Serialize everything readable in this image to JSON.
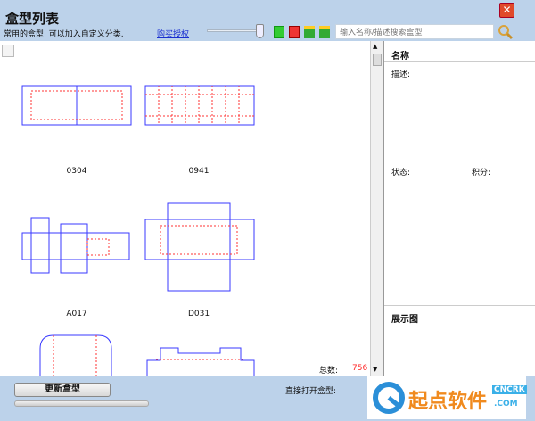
{
  "header": {
    "title": "盒型列表",
    "subtitle": "常用的盒型, 可以加入自定义分类.",
    "buy_link": "购买授权",
    "search_placeholder": "输入名称/描述搜索盒型",
    "slider_value": 1.0
  },
  "boxes": [
    {
      "label": "0304"
    },
    {
      "label": "0941"
    },
    {
      "label": "A017"
    },
    {
      "label": "D031"
    }
  ],
  "footer_list": {
    "total_label": "总数:",
    "total_value": "756"
  },
  "details": {
    "name_label": "名称",
    "desc_label": "描述:",
    "status_label": "状态:",
    "score_label": "积分:",
    "preview_label": "展示图"
  },
  "bottom": {
    "update_button": "更新盒型",
    "open_label": "直接打开盒型:"
  },
  "watermark": {
    "text": "起点软件",
    "brand": "CNCRK",
    ".com": ".COM"
  },
  "colors": {
    "dieline": "#3a3aff",
    "fold": "#ff2020",
    "total": "#ff2020"
  }
}
